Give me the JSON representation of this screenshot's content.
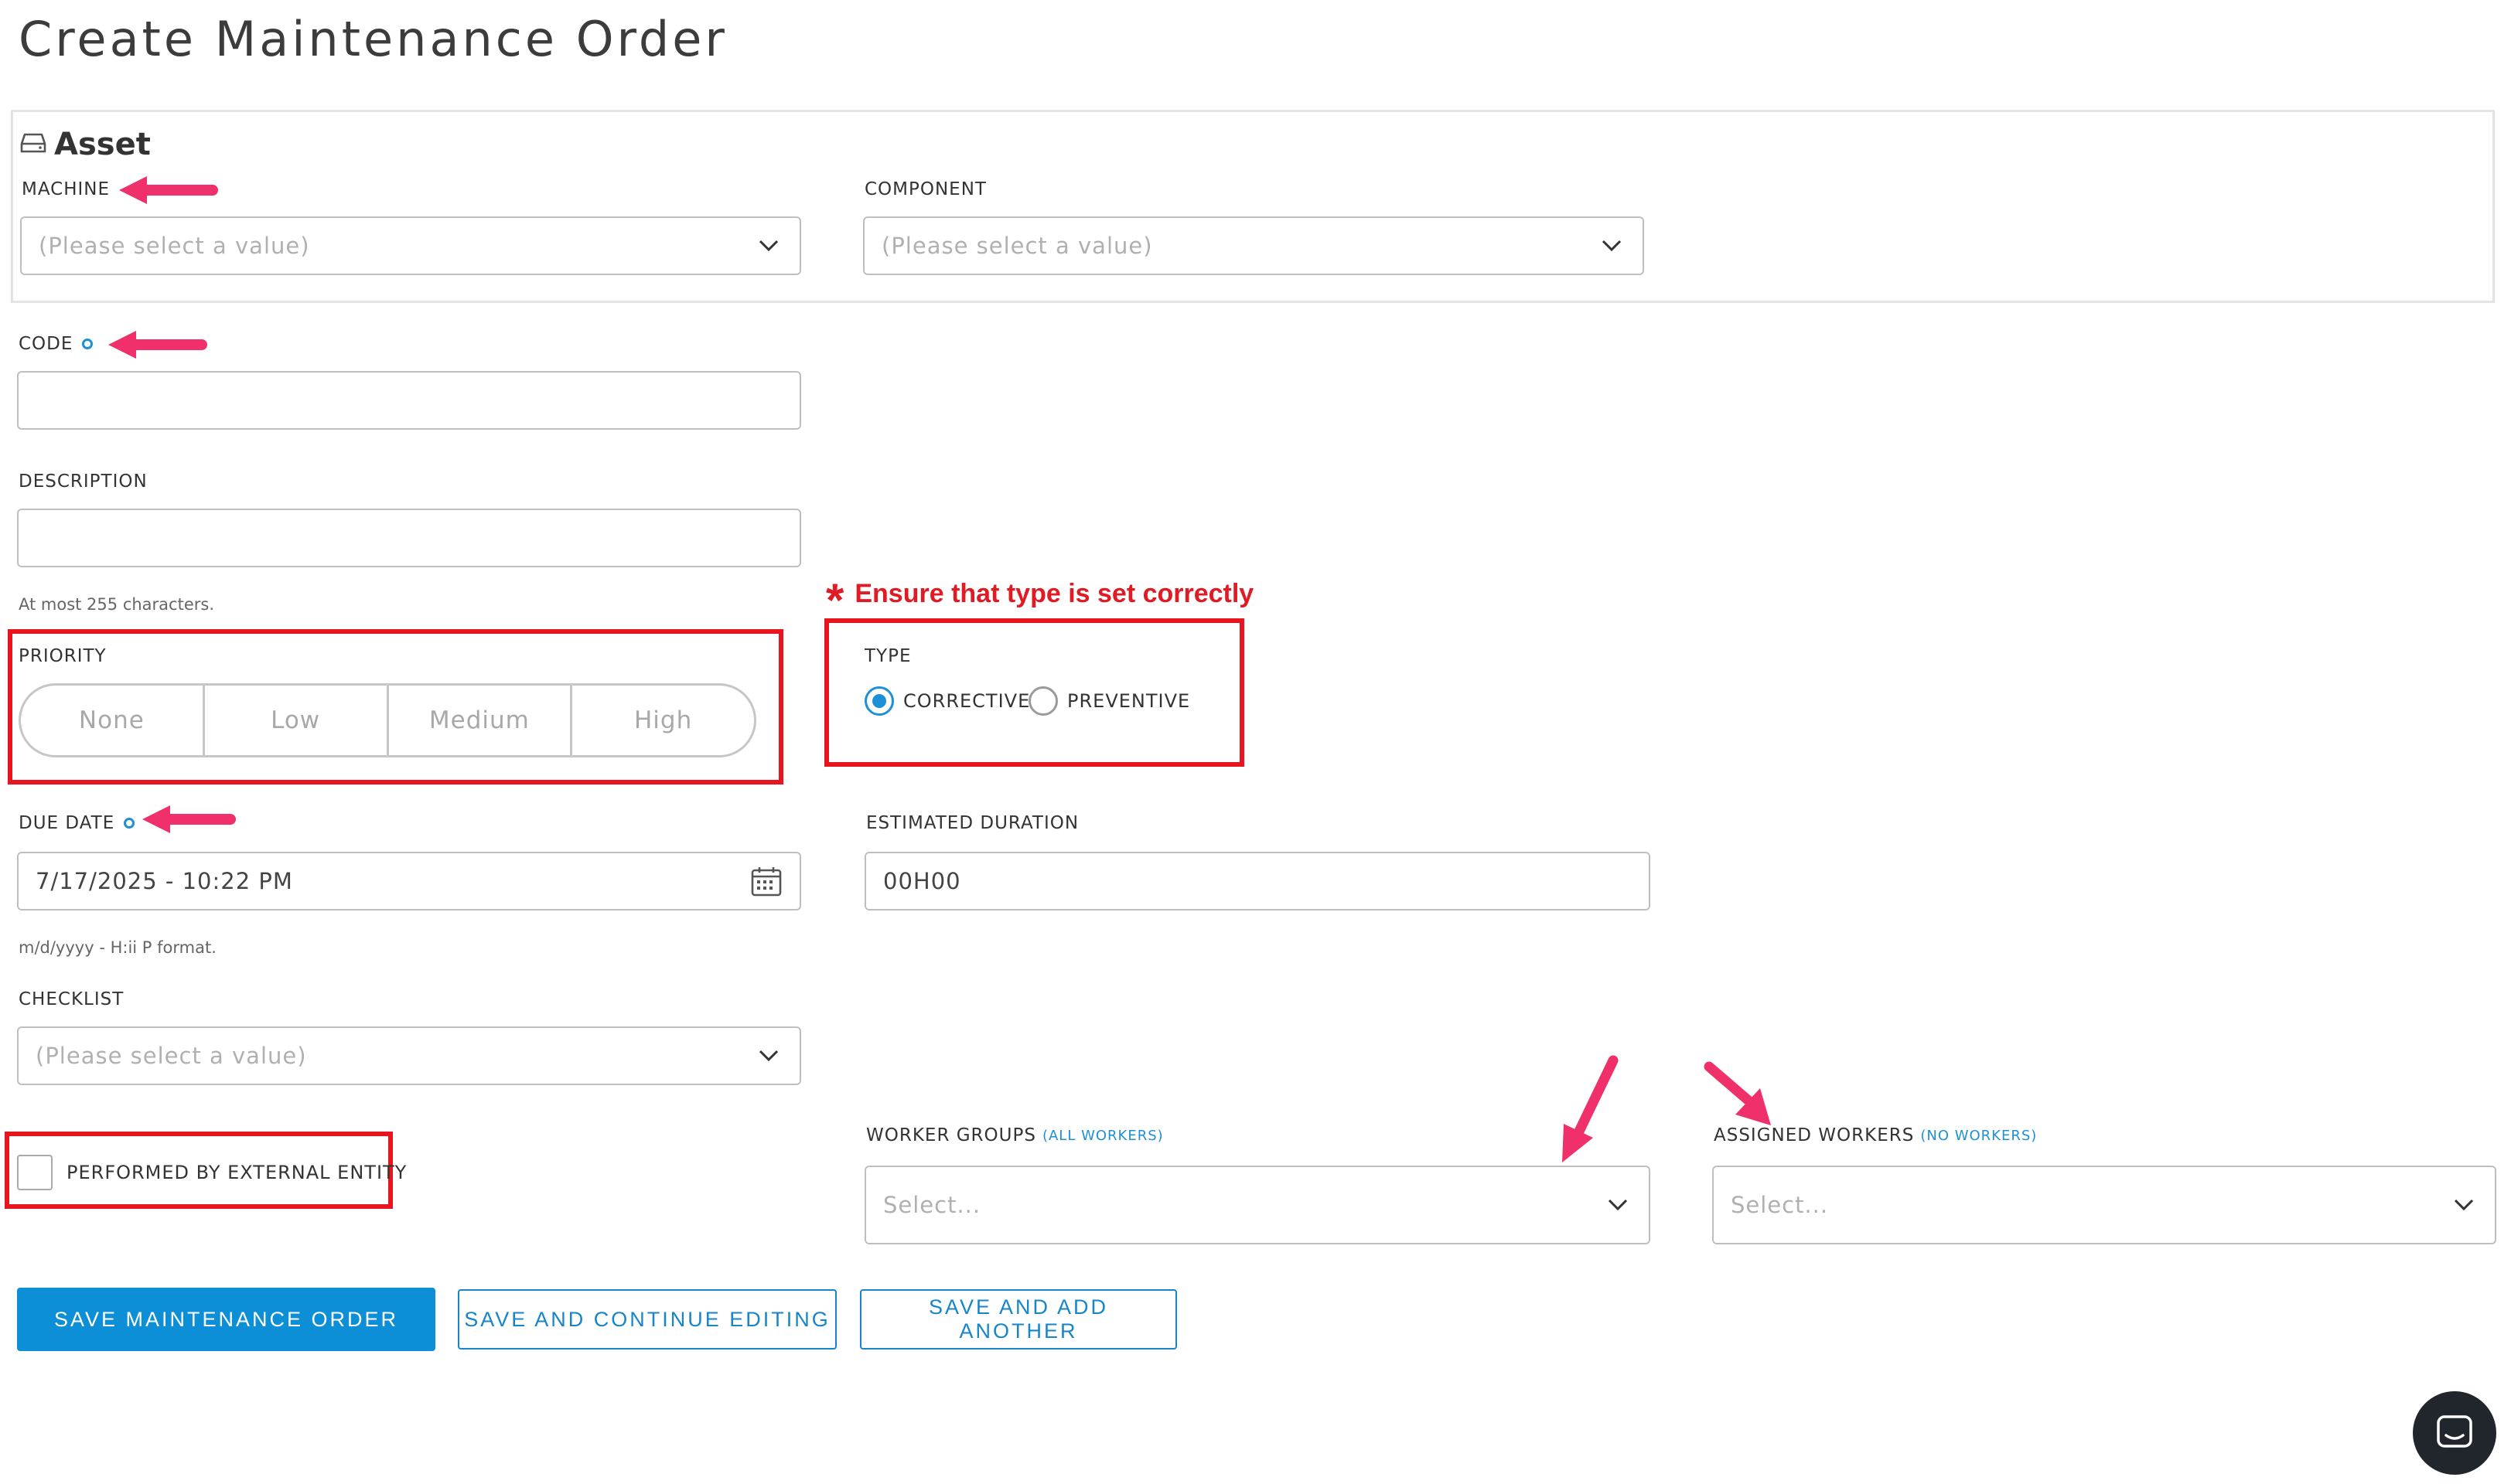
{
  "page": {
    "title": "Create Maintenance Order"
  },
  "asset": {
    "heading": "Asset",
    "heading_icon": "hard-drive-icon",
    "machine": {
      "label": "MACHINE",
      "placeholder": "(Please select a value)"
    },
    "component": {
      "label": "COMPONENT",
      "placeholder": "(Please select a value)"
    }
  },
  "code": {
    "label": "CODE",
    "value": ""
  },
  "description": {
    "label": "DESCRIPTION",
    "value": "",
    "hint": "At most 255 characters."
  },
  "priority": {
    "label": "PRIORITY",
    "options": [
      "None",
      "Low",
      "Medium",
      "High"
    ],
    "selected": null
  },
  "type": {
    "label": "TYPE",
    "options": [
      {
        "label": "CORRECTIVE",
        "checked": true
      },
      {
        "label": "PREVENTIVE",
        "checked": false
      }
    ]
  },
  "due_date": {
    "label": "DUE DATE",
    "value": "7/17/2025 - 10:22 PM",
    "hint": "m/d/yyyy - H:ii P format.",
    "icon": "calendar-icon"
  },
  "estimated_duration": {
    "label": "ESTIMATED DURATION",
    "value": "00H00"
  },
  "checklist": {
    "label": "CHECKLIST",
    "placeholder": "(Please select a value)"
  },
  "external_entity": {
    "label": "PERFORMED BY EXTERNAL ENTITY",
    "checked": false
  },
  "worker_groups": {
    "label": "WORKER GROUPS",
    "note": "(ALL WORKERS)",
    "placeholder": "Select..."
  },
  "assigned_workers": {
    "label": "ASSIGNED WORKERS",
    "note": "(NO WORKERS)",
    "placeholder": "Select..."
  },
  "buttons": {
    "save": "SAVE MAINTENANCE ORDER",
    "save_continue": "SAVE AND CONTINUE EDITING",
    "save_add": "SAVE AND ADD ANOTHER"
  },
  "annotations": {
    "type_note": "Ensure that type is set correctly",
    "type_note_marker": "*",
    "colors": {
      "box": "#e8141f",
      "arrow": "#f0306a",
      "note": "#e01b24"
    }
  },
  "colors": {
    "accent": "#0c8fd6",
    "required_dot": "#1e90d6"
  },
  "chat_widget": {
    "icon": "chat-bubble-icon"
  }
}
